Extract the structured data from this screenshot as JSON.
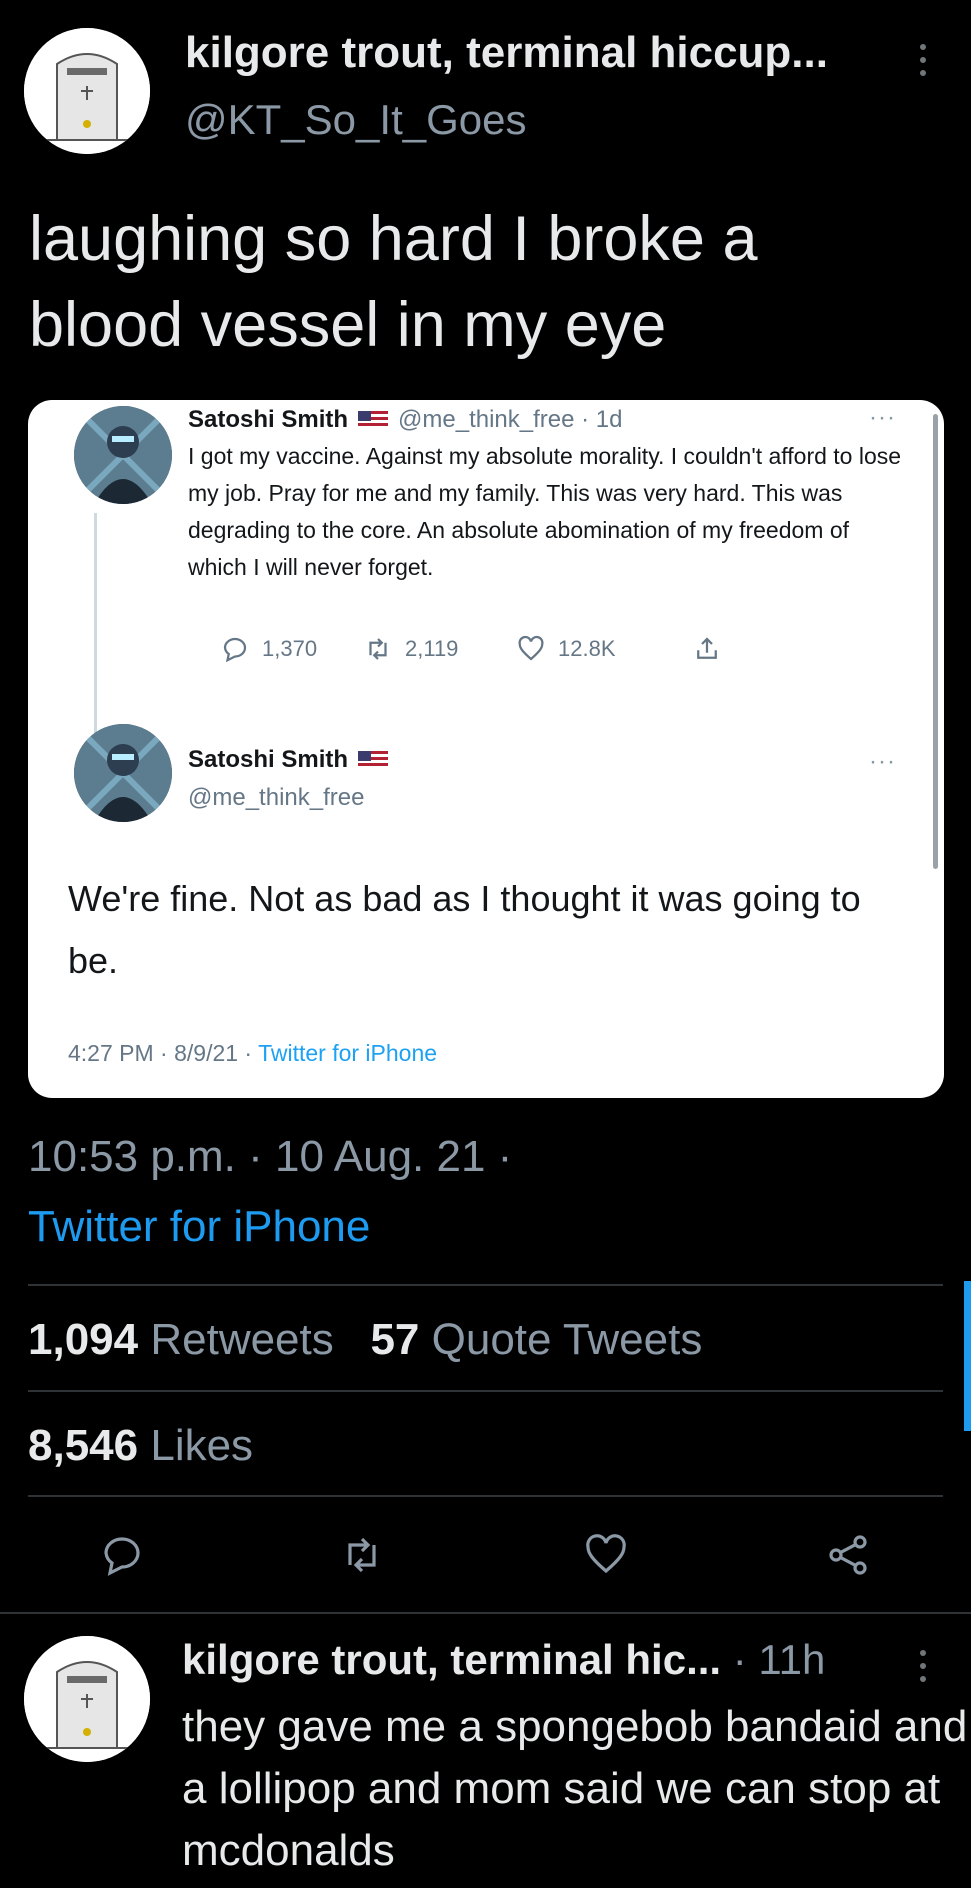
{
  "tweet": {
    "author_name": "kilgore trout, terminal hiccup...",
    "author_handle": "@KT_So_It_Goes",
    "text": "laughing so hard I broke a blood vessel in my eye",
    "timestamp": "10:53 p.m. · 10 Aug. 21 ·",
    "source": "Twitter for iPhone",
    "retweets_count": "1,094",
    "retweets_label": "Retweets",
    "quotes_count": "57",
    "quotes_label": "Quote Tweets",
    "likes_count": "8,546",
    "likes_label": "Likes"
  },
  "embedded": {
    "first": {
      "name": "Satoshi Smith",
      "meta": "@me_think_free · 1d",
      "text": "I got my vaccine. Against my absolute morality. I couldn't afford to lose my job. Pray for me and my family. This was very hard. This was degrading to the core. An absolute abomination of my freedom of which I will never forget.",
      "replies": "1,370",
      "retweets": "2,119",
      "likes": "12.8K",
      "more": "···"
    },
    "second": {
      "name": "Satoshi Smith",
      "handle": "@me_think_free",
      "text": "We're fine. Not as bad as I thought it was going to be.",
      "time": "4:27 PM · 8/9/21 · ",
      "source": "Twitter for iPhone",
      "more": "···"
    }
  },
  "reply": {
    "author_name": "kilgore trout, terminal hic...",
    "time": " · 11h",
    "text": "they gave me a spongebob bandaid and a lollipop and mom said we can stop at mcdonalds"
  },
  "icons": [
    "kebab-icon",
    "reply-icon",
    "retweet-icon",
    "like-icon",
    "share-icon"
  ],
  "colors": {
    "accent": "#1d9bf0",
    "background": "#000000",
    "muted": "#8b98a5"
  }
}
